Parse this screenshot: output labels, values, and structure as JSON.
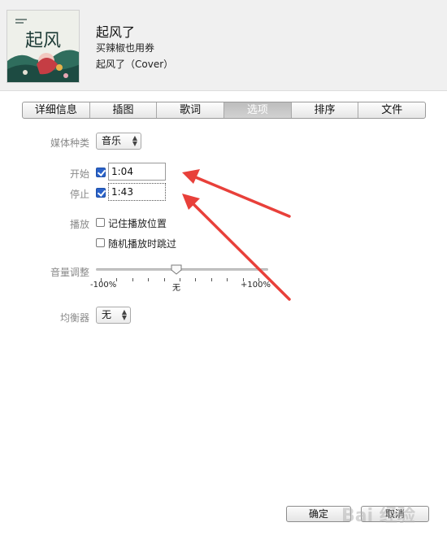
{
  "header": {
    "title": "起风了",
    "artist": "买辣椒也用券",
    "album": "起风了（Cover）",
    "cover_text": "起风"
  },
  "tabs": [
    {
      "label": "详细信息",
      "active": false
    },
    {
      "label": "插图",
      "active": false
    },
    {
      "label": "歌词",
      "active": false
    },
    {
      "label": "选项",
      "active": true
    },
    {
      "label": "排序",
      "active": false
    },
    {
      "label": "文件",
      "active": false
    }
  ],
  "options": {
    "media_kind_label": "媒体种类",
    "media_kind_value": "音乐",
    "start_label": "开始",
    "start_checked": true,
    "start_value": "1:04",
    "stop_label": "停止",
    "stop_checked": true,
    "stop_value": "1:43",
    "playback_label": "播放",
    "remember_position_label": "记住播放位置",
    "remember_position_checked": false,
    "skip_shuffle_label": "随机播放时跳过",
    "skip_shuffle_checked": false,
    "volume_label": "音量调整",
    "volume_min_label": "-100%",
    "volume_mid_label": "无",
    "volume_max_label": "+100%",
    "volume_value_percent": 0,
    "equalizer_label": "均衡器",
    "equalizer_value": "无"
  },
  "footer": {
    "ok_label": "确定",
    "cancel_label": "取消"
  },
  "watermark": "Bai 经验",
  "colors": {
    "annotation_arrow": "#e8403a",
    "checkbox_checked": "#2a62c9",
    "active_tab": "#c4c4c4"
  }
}
